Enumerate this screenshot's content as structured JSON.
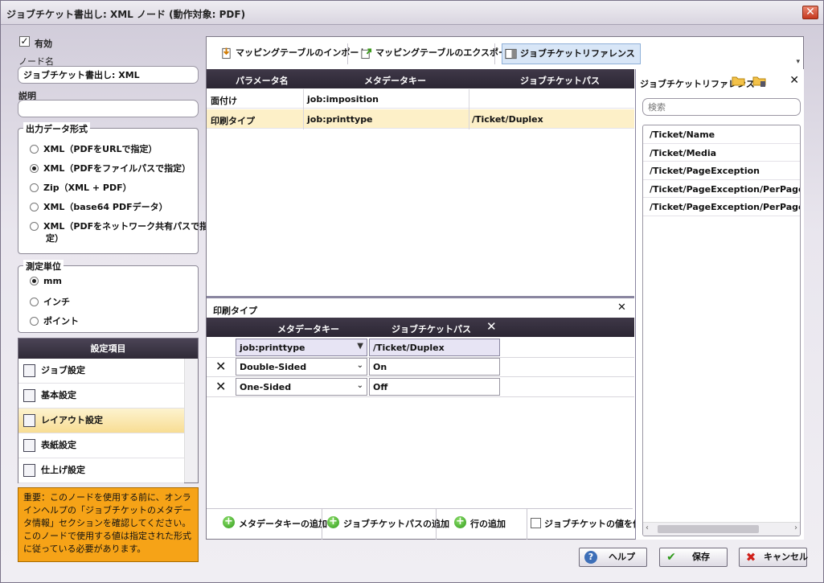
{
  "window": {
    "title": "ジョブチケット書出し: XML ノード (動作対象: PDF)",
    "close_glyph": "✕"
  },
  "left": {
    "enabled_label": "有効",
    "node_name_label": "ノード名",
    "node_name_value": "ジョブチケット書出し: XML",
    "description_label": "説明",
    "description_value": "",
    "output_format": {
      "title": "出力データ形式",
      "options": [
        {
          "label": "XML（PDFをURLで指定）",
          "selected": false
        },
        {
          "label": "XML（PDFをファイルパスで指定）",
          "selected": true
        },
        {
          "label": "Zip（XML + PDF）",
          "selected": false
        },
        {
          "label": "XML（base64 PDFデータ）",
          "selected": false
        },
        {
          "label": "XML（PDFをネットワーク共有パスで指",
          "label2": "定）",
          "selected": false
        }
      ]
    },
    "units": {
      "title": "測定単位",
      "options": [
        {
          "label": "mm",
          "selected": true
        },
        {
          "label": "インチ",
          "selected": false
        },
        {
          "label": "ポイント",
          "selected": false
        }
      ]
    },
    "settings": {
      "header": "設定項目",
      "items": [
        {
          "label": "ジョブ設定",
          "active": false
        },
        {
          "label": "基本設定",
          "active": false
        },
        {
          "label": "レイアウト設定",
          "active": true
        },
        {
          "label": "表紙設定",
          "active": false
        },
        {
          "label": "仕上げ設定",
          "active": false
        }
      ]
    },
    "warning": "重要：このノードを使用する前に、オンラインヘルプの「ジョブチケットのメタデータ情報」セクションを確認してください。このノードで使用する値は指定された形式に従っている必要があります。"
  },
  "toolbar": {
    "import_label": "マッピングテーブルのインポート",
    "export_label": "マッピングテーブルのエクスポート",
    "reference_label": "ジョブチケットリファレンス"
  },
  "mapping_table": {
    "columns": [
      "パラメータ名",
      "メタデータキー",
      "ジョブチケットパス"
    ],
    "rows": [
      {
        "param": "面付け",
        "key": "job:imposition",
        "path": ""
      },
      {
        "param": "印刷タイプ",
        "key": "job:printtype",
        "path": "/Ticket/Duplex"
      }
    ]
  },
  "detail": {
    "title": "印刷タイプ",
    "columns": [
      "メタデータキー",
      "ジョブチケットパス"
    ],
    "key_select": "job:printtype",
    "path_value": "/Ticket/Duplex",
    "rows": [
      {
        "key": "Double-Sided",
        "value": "On"
      },
      {
        "key": "One-Sided",
        "value": "Off"
      }
    ],
    "add_key_label": "メタデータキーの追加",
    "add_path_label": "ジョブチケットパスの追加",
    "add_row_label": "行の追加",
    "use_values_label": "ジョブチケットの値を使用"
  },
  "reference": {
    "title": "ジョブチケットリファレンス",
    "search_placeholder": "検索",
    "items": [
      "/Ticket/Name",
      "/Ticket/Media",
      "/Ticket/PageException",
      "/Ticket/PageException/PerPageSetti",
      "/Ticket/PageException/PerPageSetti"
    ]
  },
  "buttons": {
    "help": "ヘルプ",
    "save": "保存",
    "cancel": "キャンセル"
  },
  "colors": {
    "accent_header": "#2f2a37",
    "selected_row": "#fdf0c8",
    "warning_bg": "#f6a317"
  }
}
